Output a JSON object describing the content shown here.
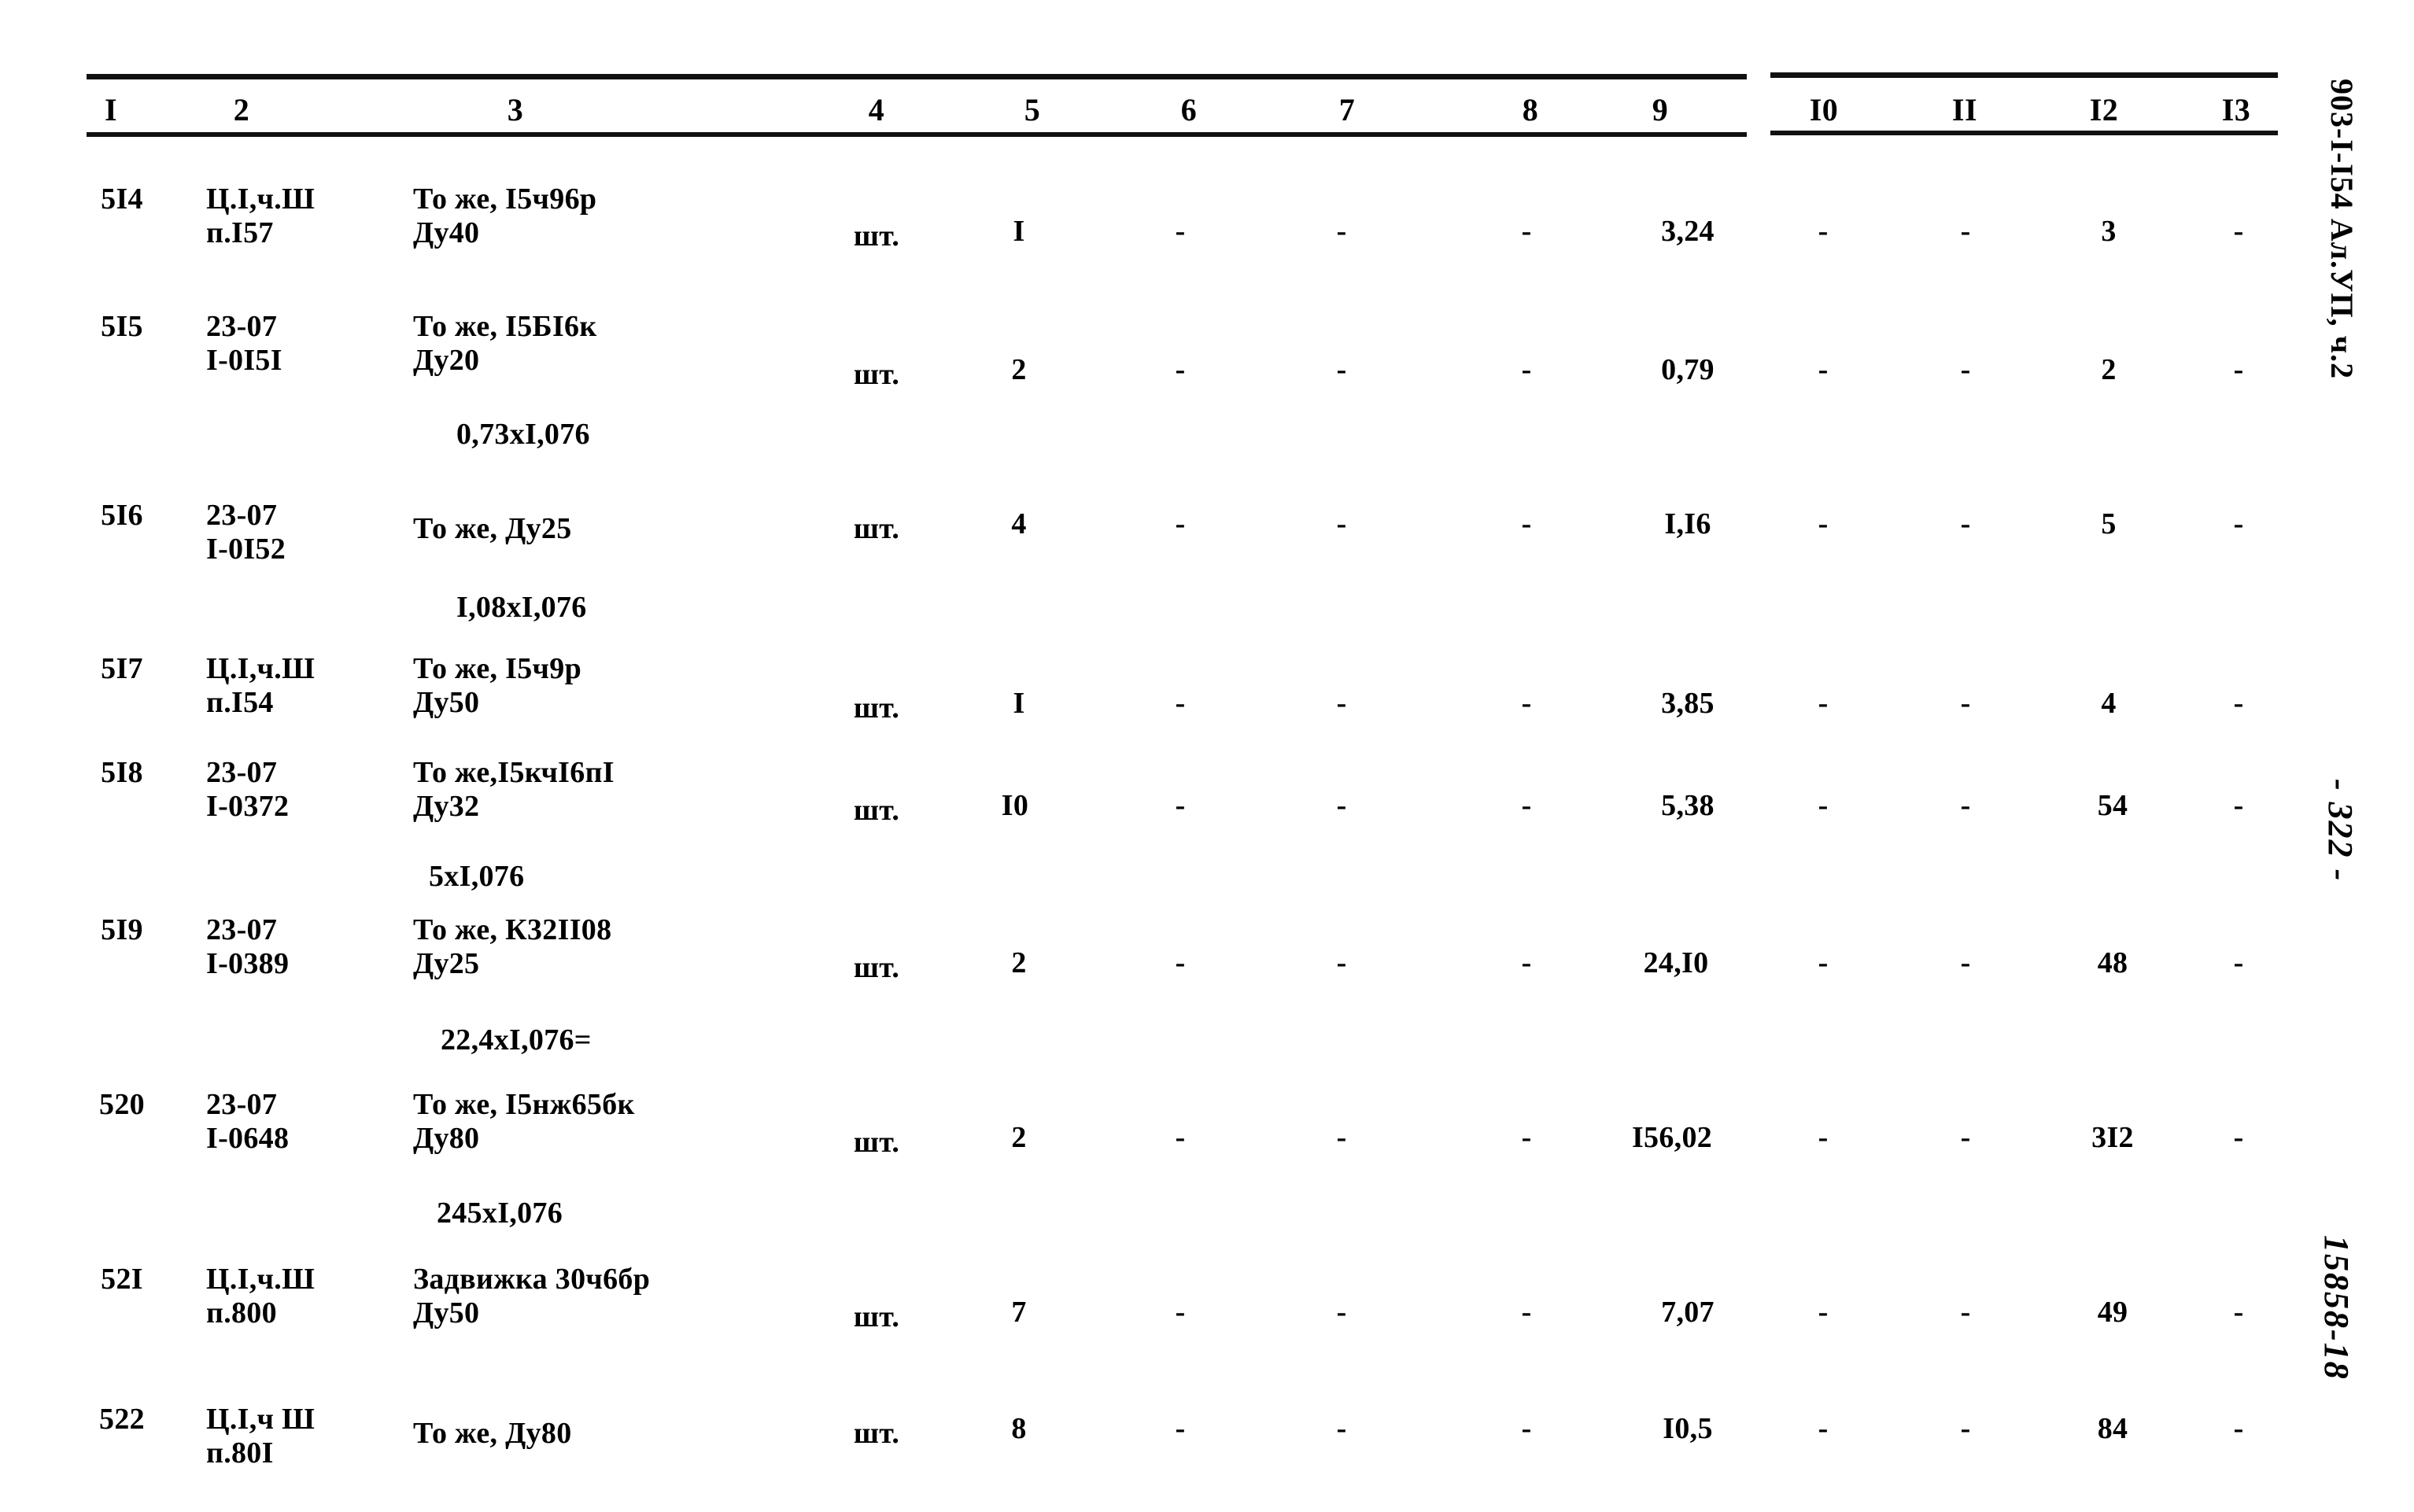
{
  "document": {
    "table_headers": [
      "I",
      "2",
      "3",
      "4",
      "5",
      "6",
      "7",
      "8",
      "9",
      "I0",
      "II",
      "I2",
      "I3"
    ],
    "rows": [
      {
        "num": "5I4",
        "code_line1": "Ц.I,ч.Ш",
        "code_line2": "п.I57",
        "name_line1": "То же, I5ч96р",
        "name_line2": "Ду40",
        "subnote": "",
        "unit": "шт.",
        "col5": "I",
        "col6": "-",
        "col7": "-",
        "col8": "-",
        "col9": "3,24",
        "col10": "-",
        "col11": "-",
        "col12": "3",
        "col13": "-"
      },
      {
        "num": "5I5",
        "code_line1": "23-07",
        "code_line2": "I-0I5I",
        "name_line1": "То же, I5БI6к",
        "name_line2": "Ду20",
        "subnote": "0,73xI,076",
        "unit": "шт.",
        "col5": "2",
        "col6": "-",
        "col7": "-",
        "col8": "-",
        "col9": "0,79",
        "col10": "-",
        "col11": "-",
        "col12": "2",
        "col13": "-"
      },
      {
        "num": "5I6",
        "code_line1": "23-07",
        "code_line2": "I-0I52",
        "name_line1": "То же, Ду25",
        "name_line2": "",
        "subnote": "I,08xI,076",
        "unit": "шт.",
        "col5": "4",
        "col6": "-",
        "col7": "-",
        "col8": "-",
        "col9": "I,I6",
        "col10": "-",
        "col11": "-",
        "col12": "5",
        "col13": "-"
      },
      {
        "num": "5I7",
        "code_line1": "Ц.I,ч.Ш",
        "code_line2": "п.I54",
        "name_line1": "То же, I5ч9р",
        "name_line2": "Ду50",
        "subnote": "",
        "unit": "шт.",
        "col5": "I",
        "col6": "-",
        "col7": "-",
        "col8": "-",
        "col9": "3,85",
        "col10": "-",
        "col11": "-",
        "col12": "4",
        "col13": "-"
      },
      {
        "num": "5I8",
        "code_line1": "23-07",
        "code_line2": "I-0372",
        "name_line1": "То же,I5кчI6пI",
        "name_line2": "Ду32",
        "subnote": "5xI,076",
        "unit": "шт.",
        "col5": "I0",
        "col6": "-",
        "col7": "-",
        "col8": "-",
        "col9": "5,38",
        "col10": "-",
        "col11": "-",
        "col12": "54",
        "col13": "-"
      },
      {
        "num": "5I9",
        "code_line1": "23-07",
        "code_line2": "I-0389",
        "name_line1": "То же, К32II08",
        "name_line2": "Ду25",
        "subnote": "22,4xI,076=",
        "unit": "шт.",
        "col5": "2",
        "col6": "-",
        "col7": "-",
        "col8": "-",
        "col9": "24,I0",
        "col10": "-",
        "col11": "-",
        "col12": "48",
        "col13": "-"
      },
      {
        "num": "520",
        "code_line1": "23-07",
        "code_line2": "I-0648",
        "name_line1": "То же, I5нж65бк",
        "name_line2": "Ду80",
        "subnote": "245xI,076",
        "unit": "шт.",
        "col5": "2",
        "col6": "-",
        "col7": "-",
        "col8": "-",
        "col9": "I56,02",
        "col10": "-",
        "col11": "-",
        "col12": "3I2",
        "col13": "-"
      },
      {
        "num": "52I",
        "code_line1": "Ц.I,ч.Ш",
        "code_line2": "п.800",
        "name_line1": "Задвижка 30ч6бр",
        "name_line2": "Ду50",
        "subnote": "",
        "unit": "шт.",
        "col5": "7",
        "col6": "-",
        "col7": "-",
        "col8": "-",
        "col9": "7,07",
        "col10": "-",
        "col11": "-",
        "col12": "49",
        "col13": "-"
      },
      {
        "num": "522",
        "code_line1": "Ц.I,ч Ш",
        "code_line2": "п.80I",
        "name_line1": "То же, Ду80",
        "name_line2": "",
        "subnote": "",
        "unit": "шт.",
        "col5": "8",
        "col6": "-",
        "col7": "-",
        "col8": "-",
        "col9": "I0,5",
        "col10": "-",
        "col11": "-",
        "col12": "84",
        "col13": "-"
      }
    ],
    "margin": {
      "series_code": "903-I-I54 Ал.УП, ч.2",
      "page_number": "- 322 -",
      "archive_number": "15858-18"
    }
  }
}
